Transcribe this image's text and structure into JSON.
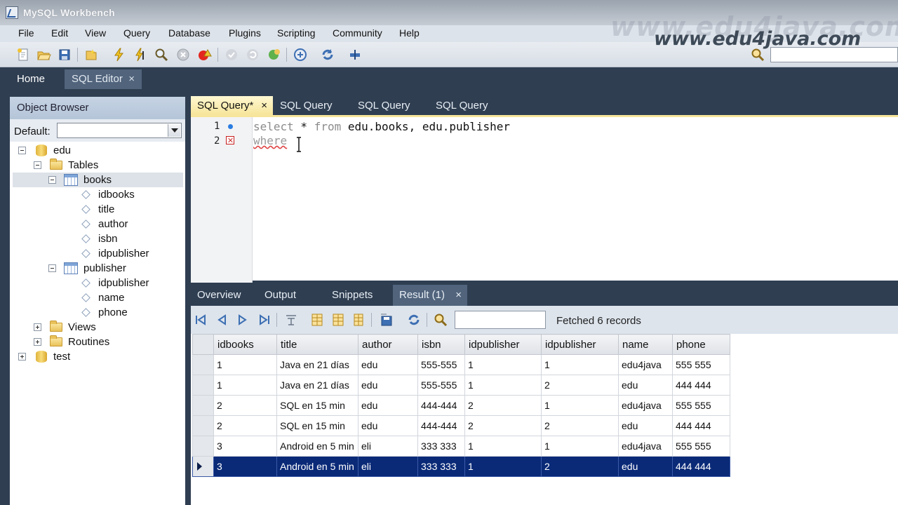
{
  "window": {
    "title": "MySQL Workbench"
  },
  "watermark": {
    "back": "www.edu4java.com",
    "front": "www.edu4java.com"
  },
  "menu": [
    "File",
    "Edit",
    "View",
    "Query",
    "Database",
    "Plugins",
    "Scripting",
    "Community",
    "Help"
  ],
  "main_tabs": {
    "home": "Home",
    "sql_editor": "SQL Editor",
    "close": "×"
  },
  "object_browser": {
    "header": "Object Browser",
    "default_label": "Default:",
    "default_value": "",
    "tree": {
      "db1": "edu",
      "tables": "Tables",
      "books": "books",
      "books_cols": [
        "idbooks",
        "title",
        "author",
        "isbn",
        "idpublisher"
      ],
      "publisher": "publisher",
      "publisher_cols": [
        "idpublisher",
        "name",
        "phone"
      ],
      "views": "Views",
      "routines": "Routines",
      "db2": "test"
    }
  },
  "query_tabs": [
    "SQL Query*",
    "SQL Query",
    "SQL Query",
    "SQL Query"
  ],
  "editor": {
    "line_numbers": [
      "1",
      "2"
    ],
    "line1": {
      "kw1": "select",
      "rest1": " * ",
      "kw2": "from",
      "rest2": " edu.books, edu.publisher"
    },
    "line2": {
      "word": "where"
    }
  },
  "bottom_tabs": [
    "Overview",
    "Output",
    "Snippets",
    "Result (1)"
  ],
  "result": {
    "filter_value": "",
    "status": "Fetched 6 records",
    "columns": [
      "idbooks",
      "title",
      "author",
      "isbn",
      "idpublisher",
      "idpublisher",
      "name",
      "phone"
    ],
    "rows": [
      [
        "1",
        "Java en 21 días",
        "edu",
        "555-555",
        "1",
        "1",
        "edu4java",
        "555 555"
      ],
      [
        "1",
        "Java en 21 días",
        "edu",
        "555-555",
        "1",
        "2",
        "edu",
        "444 444"
      ],
      [
        "2",
        "SQL en 15 min",
        "edu",
        "444-444",
        "2",
        "1",
        "edu4java",
        "555 555"
      ],
      [
        "2",
        "SQL en 15 min",
        "edu",
        "444-444",
        "2",
        "2",
        "edu",
        "444 444"
      ],
      [
        "3",
        "Android en 5 min",
        "eli",
        "333 333",
        "1",
        "1",
        "edu4java",
        "555 555"
      ],
      [
        "3",
        "Android en 5 min",
        "eli",
        "333 333",
        "1",
        "2",
        "edu",
        "444 444"
      ]
    ],
    "selected_row_index": 5
  },
  "colors": {
    "dark_chrome": "#2f3e51",
    "active_query_tab": "#f6e59a",
    "selected_row": "#0a2a78"
  }
}
